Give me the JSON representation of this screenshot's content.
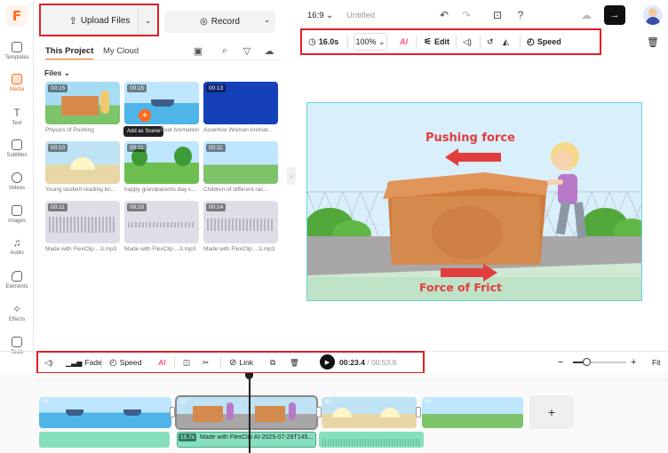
{
  "app": {
    "logo_letter": "F"
  },
  "rail": {
    "items": [
      {
        "label": "Templates"
      },
      {
        "label": "Media"
      },
      {
        "label": "Text"
      },
      {
        "label": "Subtitles"
      },
      {
        "label": "Videos"
      },
      {
        "label": "Images"
      },
      {
        "label": "Audio"
      },
      {
        "label": "Elements"
      },
      {
        "label": "Effects"
      },
      {
        "label": "Tools"
      }
    ],
    "active": "Media"
  },
  "media": {
    "upload_label": "Upload Files",
    "record_label": "Record",
    "tabs": [
      "This Project",
      "My Cloud"
    ],
    "files_label": "Files",
    "add_as_scene": "Add as Scene",
    "files": [
      {
        "duration": "00:15",
        "caption": "Physics of Pushing"
      },
      {
        "duration": "00:15",
        "caption": "Cartoon Boat Animation ..."
      },
      {
        "duration": "00:13",
        "caption": "Assertive Woman Animat..."
      },
      {
        "duration": "00:10",
        "caption": "Young student reading bo..."
      },
      {
        "duration": "00:11",
        "caption": "happy grandparents day c..."
      },
      {
        "duration": "00:11",
        "caption": "Children of different rac..."
      },
      {
        "duration": "00:11",
        "caption": "Made with FlexClip ...3.mp3"
      },
      {
        "duration": "00:20",
        "caption": "Made with FlexClip ...3.mp3"
      },
      {
        "duration": "00:14",
        "caption": "Made with FlexClip ...3.mp3"
      }
    ]
  },
  "topbar": {
    "ratio": "16:9",
    "title": "Untitled"
  },
  "canvas_toolbar": {
    "duration": "16.0s",
    "zoom": "100%",
    "ai": "AI",
    "edit": "Edit",
    "speed": "Speed"
  },
  "stage": {
    "label_top": "Pushing force",
    "label_bottom": "Force of Frict"
  },
  "timeline_toolbar": {
    "fade": "Fade",
    "speed": "Speed",
    "ai": "AI",
    "link": "Link",
    "time_current": "00:23.4",
    "time_total": "/ 00:53.8",
    "fit": "Fit",
    "zoom_level": 0.25
  },
  "timeline": {
    "clips": [
      "01",
      "02",
      "03",
      "04"
    ],
    "add": "+",
    "audio_duration": "15.7s",
    "audio_label": "Made with FlexClip AI-2025-07-29T145..."
  },
  "colors": {
    "accent": "#ff6a1a",
    "highlight": "#e31e24"
  }
}
